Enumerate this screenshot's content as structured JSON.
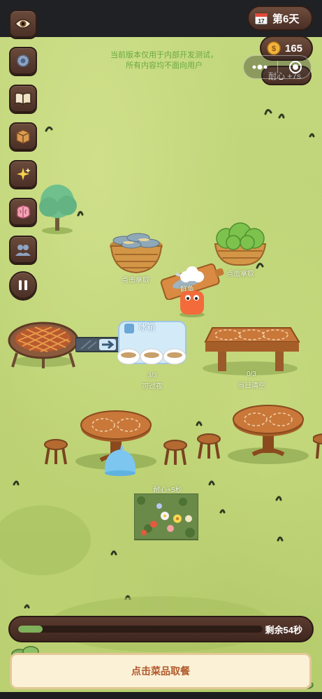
{
  "topbar": {
    "day_label": "第6天",
    "calendar_number": "17",
    "coins": "165",
    "patience_bonus": "耐心 +7s"
  },
  "notice": {
    "line1": "当前版本仅用于内部开发测试，",
    "line2": "所有内容均不面向用户"
  },
  "sidebar": {
    "items": [
      {
        "name": "view",
        "icon": "eye-icon"
      },
      {
        "name": "settings",
        "icon": "gear-icon"
      },
      {
        "name": "recipes",
        "icon": "book-icon"
      },
      {
        "name": "inventory",
        "icon": "box-icon"
      },
      {
        "name": "effects",
        "icon": "sparkle-icon"
      },
      {
        "name": "skills",
        "icon": "brain-icon"
      },
      {
        "name": "staff",
        "icon": "people-icon"
      },
      {
        "name": "pause",
        "icon": "pause-icon"
      }
    ]
  },
  "stations": {
    "fish_basket_label": "点击拿取",
    "lettuce_basket_label": "点击拿取",
    "cutting_board_item": "鲜鱼",
    "fridge_title": "冰箱",
    "fridge_count": "3/3",
    "fridge_note": "可过夜",
    "counter_count": "0/3",
    "counter_note": "当日清空",
    "flowerbed_label": "耐心+5秒"
  },
  "timer": {
    "progress": 0.1,
    "remaining_label": "剩余54秒"
  },
  "order_panel": {
    "prompt": "点击菜品取餐"
  },
  "colors": {
    "field": "#c3d77d",
    "button_brown": "#5a3b2f",
    "progress_green": "#7fb05a",
    "order_text": "#b25a2c",
    "notice_green": "#5fa53a"
  }
}
